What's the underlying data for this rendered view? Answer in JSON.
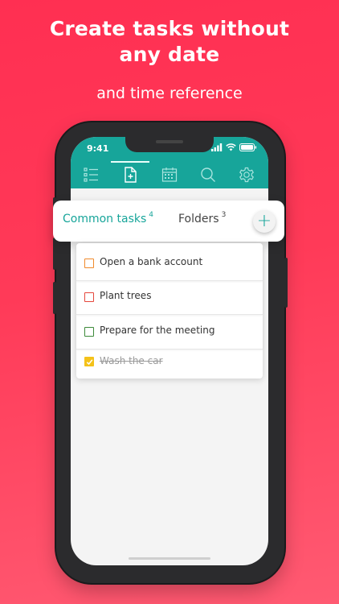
{
  "promo": {
    "headline_line1": "Create tasks without",
    "headline_line2": "any date",
    "subline": "and time reference"
  },
  "status_bar": {
    "time": "9:41"
  },
  "tabbar": {
    "items": [
      {
        "icon": "checklist-icon",
        "active": false
      },
      {
        "icon": "new-document-icon",
        "active": true
      },
      {
        "icon": "calendar-icon",
        "active": false
      },
      {
        "icon": "search-icon",
        "active": false
      },
      {
        "icon": "settings-gear-icon",
        "active": false
      }
    ]
  },
  "tabs": {
    "common_label": "Common tasks",
    "common_count": "4",
    "folders_label": "Folders",
    "folders_count": "3",
    "add_symbol": "+"
  },
  "tasks": [
    {
      "text": "Open a bank account",
      "color": "#f08a2c",
      "done": false
    },
    {
      "text": "Plant trees",
      "color": "#e5473c",
      "done": false
    },
    {
      "text": "Prepare for the meeting",
      "color": "#3d8a3a",
      "done": false
    },
    {
      "text": "Wash the car",
      "color": "#f4c21a",
      "done": true
    }
  ],
  "colors": {
    "background": "#ff3a58",
    "accent": "#17a59a"
  }
}
